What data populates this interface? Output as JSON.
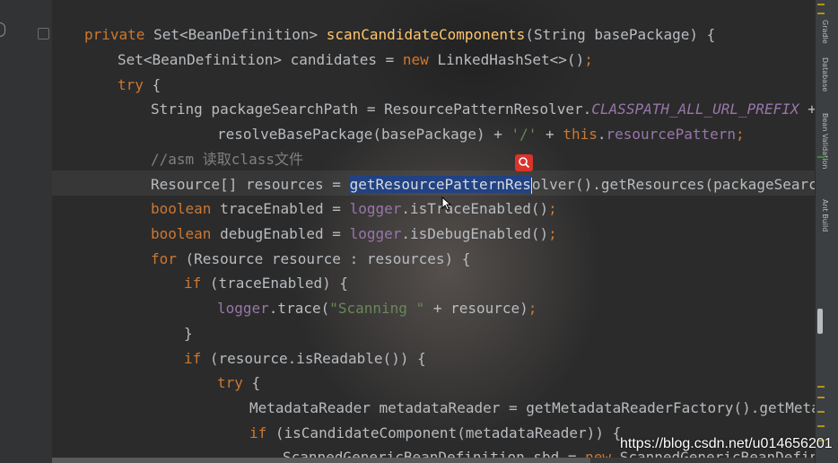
{
  "code": {
    "l1": {
      "kw_private": "private",
      "type": "Set<BeanDefinition>",
      "method": "scanCandidateComponents",
      "params": "(String basePackage) {"
    },
    "l2": {
      "type": "Set<BeanDefinition> candidates = ",
      "kw_new": "new",
      "rest": "LinkedHashSet<>()",
      "semi": ";"
    },
    "l3": {
      "kw_try": "try",
      "rest": " {"
    },
    "l4": {
      "text": "String packageSearchPath = ResourcePatternResolver.",
      "const": "CLASSPATH_ALL_URL_PREFIX",
      "rest": " +"
    },
    "l5": {
      "text": "resolveBasePackage(basePackage) + ",
      "str": "'/'",
      "plus": " + ",
      "kw_this": "this",
      "dot": ".",
      "field": "resourcePattern",
      "semi": ";"
    },
    "l6": {
      "comment": "//asm 读取class文件"
    },
    "l7": {
      "pre": "Resource[] resources = ",
      "sel": "getResourcePatternRes",
      "post": "olver().getResources(packageSearchPat"
    },
    "l8": {
      "kw": "boolean",
      "text": " traceEnabled = ",
      "field": "logger",
      "rest": ".isTraceEnabled()",
      "semi": ";"
    },
    "l9": {
      "kw": "boolean",
      "text": " debugEnabled = ",
      "field": "logger",
      "rest": ".isDebugEnabled()",
      "semi": ";"
    },
    "l10": {
      "kw": "for",
      "rest": " (Resource resource : resources) {"
    },
    "l11": {
      "kw": "if",
      "rest": " (traceEnabled) {"
    },
    "l12": {
      "field": "logger",
      "pre": ".trace(",
      "str": "\"Scanning \"",
      "rest": " + resource)",
      "semi": ";"
    },
    "l13": {
      "text": "}"
    },
    "l14": {
      "kw": "if",
      "rest": " (resource.isReadable()) {"
    },
    "l15": {
      "kw": "try",
      "rest": " {"
    },
    "l16": {
      "text": "MetadataReader metadataReader = getMetadataReaderFactory().getMetadat"
    },
    "l17": {
      "kw": "if",
      "rest": " (isCandidateComponent(metadataReader)) {"
    },
    "l18": {
      "text": "ScannedGenericBeanDefinition sbd = ",
      "kw_new": "new",
      "rest": " ScannedGenericBeanDefiniti"
    }
  },
  "tool_windows": [
    "Gradle",
    "Database",
    "Bean Validation",
    "Ant Build"
  ],
  "watermark": "https://blog.csdn.net/u014656201",
  "icons": [
    "breakpoint-icon",
    "fold-icon",
    "search-icon",
    "mouse-pointer-icon"
  ],
  "colors": {
    "keyword": "#cc7832",
    "method": "#ffc66d",
    "field": "#9876aa",
    "string": "#6a8759",
    "comment": "#808080",
    "selection": "#214283",
    "search_button": "#d9342b"
  }
}
